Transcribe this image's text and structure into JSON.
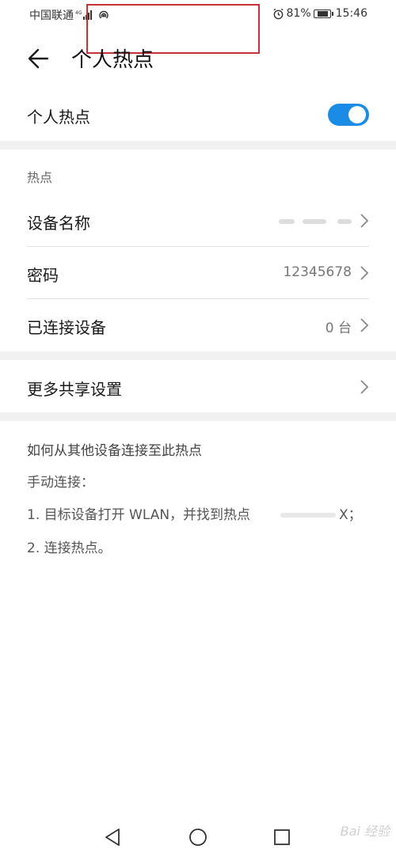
{
  "status_bar": {
    "carrier": "中国联通",
    "battery_percent_text": "81%",
    "battery_level": 0.81,
    "time": "15:46"
  },
  "header": {
    "title": "个人热点"
  },
  "hotspot_toggle": {
    "label": "个人热点",
    "on": true,
    "accent_color": "#1a8ce6"
  },
  "hotspot_section": {
    "title": "热点",
    "rows": [
      {
        "label": "设备名称",
        "value": ""
      },
      {
        "label": "密码",
        "value": "12345678"
      },
      {
        "label": "已连接设备",
        "value": "0 台"
      }
    ]
  },
  "more_sharing": {
    "label": "更多共享设置"
  },
  "help": {
    "title": "如何从其他设备连接至此热点",
    "subtitle": "手动连接：",
    "step1": "1. 目标设备打开 WLAN，并找到热点",
    "step1_tail": "X；",
    "step2": "2. 连接热点。"
  },
  "watermark": "Bai 经验",
  "icons": {
    "back": "arrow-left-icon",
    "chevron": "chevron-right-icon",
    "nav_back": "triangle-back-icon",
    "nav_home": "circle-home-icon",
    "nav_recents": "square-recents-icon"
  }
}
